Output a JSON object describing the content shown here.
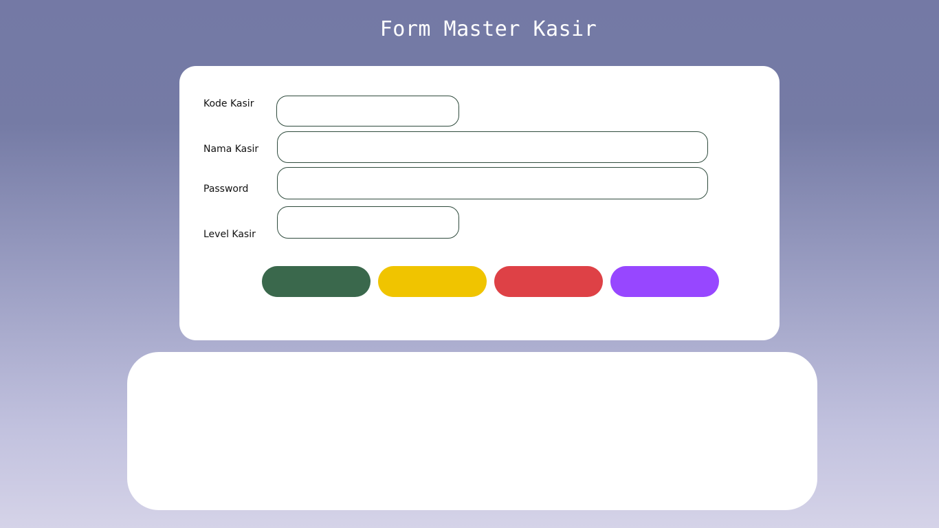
{
  "page": {
    "title": "Form Master Kasir"
  },
  "form": {
    "fields": {
      "kode_kasir": {
        "label": "Kode Kasir",
        "value": "",
        "placeholder": ""
      },
      "nama_kasir": {
        "label": "Nama Kasir",
        "value": "",
        "placeholder": ""
      },
      "password": {
        "label": "Password",
        "value": "",
        "placeholder": ""
      },
      "level_kasir": {
        "label": "Level Kasir",
        "value": "",
        "placeholder": ""
      }
    },
    "buttons": [
      {
        "label": "",
        "color": "#3a684c"
      },
      {
        "label": "",
        "color": "#f0c400"
      },
      {
        "label": "",
        "color": "#de4146"
      },
      {
        "label": "",
        "color": "#9747ff"
      }
    ]
  },
  "table": {
    "rows": []
  }
}
